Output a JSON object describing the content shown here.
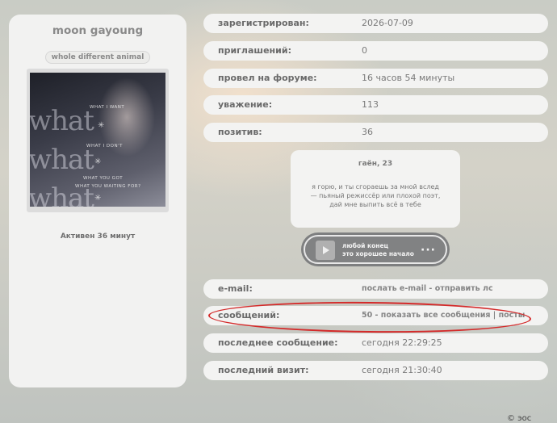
{
  "profile": {
    "username": "moon gayoung",
    "usertitle": "whole different animal",
    "avatar_text": {
      "word": "what",
      "lines": [
        "WHAT I WANT",
        "WHAT I DON'T",
        "WHAT YOU GOT",
        "WHAT YOU WAITING FOR?"
      ]
    },
    "active": "Активен 36 минут"
  },
  "stats": [
    {
      "label": "зарегистрирован:",
      "value": "2026-07-09"
    },
    {
      "label": "приглашений:",
      "value": "0"
    },
    {
      "label": "провел на форуме:",
      "value": "16 часов 54 минуты"
    },
    {
      "label": "уважение:",
      "value": "113"
    },
    {
      "label": "позитив:",
      "value": "36"
    }
  ],
  "quote": {
    "title": "гаён, 23",
    "lines": [
      "я горю, и ты сгораешь за мной вслед",
      "— пьяный режиссёр или плохой поэт,",
      "дай мне выпить всё в тебе"
    ]
  },
  "player": {
    "line1": "любой конец",
    "line2": "это хорошее начало",
    "menu": "···"
  },
  "contacts": {
    "email_label": "e-mail:",
    "email_link": "послать e-mail",
    "sep1": " - ",
    "pm_link": "отправить лс",
    "posts_label": "сообщений:",
    "posts_count": "50",
    "sep2": " - ",
    "all_posts_link": "показать все сообщения",
    "sep3": " | ",
    "topics_link": "посты",
    "last_post_label": "последнее сообщение:",
    "last_post_value": "сегодня 22:29:25",
    "last_visit_label": "последний визит:",
    "last_visit_value": "сегодня 21:30:40"
  },
  "footer": {
    "copyright": "© эос"
  },
  "colors": {
    "annotation": "#d42a2a",
    "panel": "#f3f3f2"
  }
}
